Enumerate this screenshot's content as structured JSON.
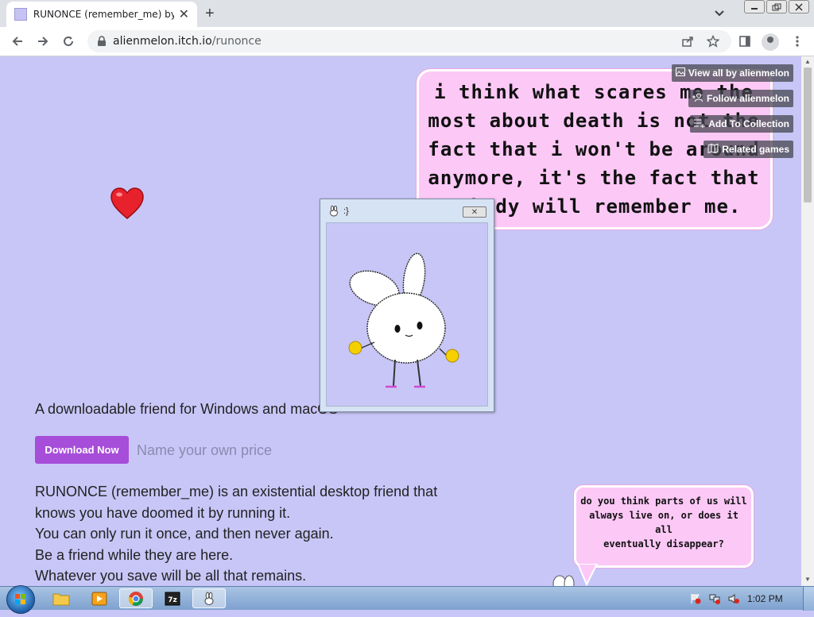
{
  "browser": {
    "tab_title": "RUNONCE (remember_me) by alienmelon",
    "url_host": "alienmelon.itch.io",
    "url_path": "/runonce",
    "newtab_glyph": "+",
    "close_glyph": "✕"
  },
  "itch_bar": {
    "view_all": "View all by alienmelon",
    "follow": "Follow alienmelon",
    "add_collection": "Add To Collection",
    "related": "Related games"
  },
  "bubble_main": {
    "lines": [
      "i think what scares me the",
      "most about death is not the",
      "fact that i won't be around",
      "anymore, it's the fact that",
      "nobody will remember me."
    ]
  },
  "popup": {
    "title": ":}",
    "close": "✕"
  },
  "page": {
    "description": "A downloadable friend for Windows and macOS",
    "download_label": "Download Now",
    "price_placeholder": "Name your own price",
    "body": [
      "RUNONCE (remember_me) is an existential desktop friend that",
      "knows you have doomed it by running it.",
      "You can only run it once, and then never again.",
      "Be a friend while they are here.",
      "Whatever you save will be all that remains."
    ]
  },
  "bubble_small": {
    "lines": [
      "do you think parts of us will",
      "always live on, or does it all",
      "eventually disappear?"
    ]
  },
  "taskbar": {
    "clock": "1:02 PM"
  },
  "colors": {
    "page_bg": "#c8c6f7",
    "bubble_bg": "#fcc8f6",
    "download_btn": "#a64dd9"
  }
}
